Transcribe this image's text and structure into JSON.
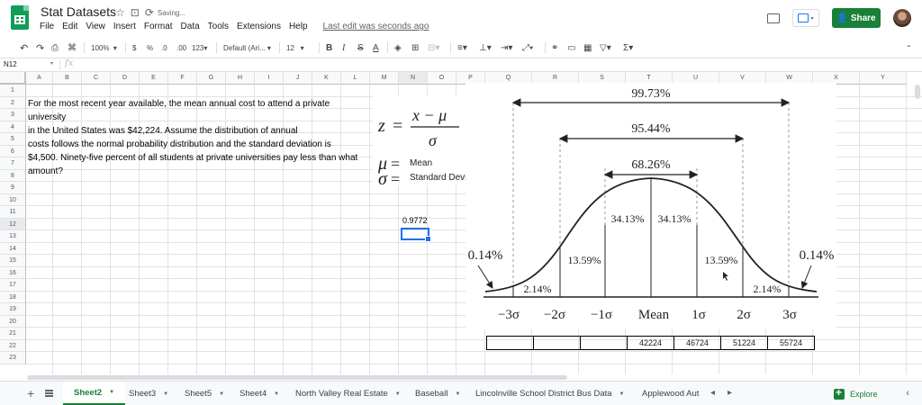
{
  "app": {
    "doc_title": "Stat Datasets",
    "saving_text": "Saving...",
    "menus": [
      "File",
      "Edit",
      "View",
      "Insert",
      "Format",
      "Data",
      "Tools",
      "Extensions",
      "Help"
    ],
    "last_edit": "Last edit was seconds ago",
    "share_label": "Share"
  },
  "toolbar": {
    "zoom": "100%",
    "currency": "$",
    "percent": "%",
    "dec_less": ".0",
    "dec_more": ".00",
    "more_formats": "123",
    "font": "Default (Ari...",
    "font_size": "12",
    "bold": "B",
    "italic": "I",
    "strike": "S",
    "text_color": "A",
    "sum": "Σ"
  },
  "formula_bar": {
    "cell_ref": "N12",
    "fx": "fx",
    "content": ""
  },
  "columns": [
    "A",
    "B",
    "C",
    "D",
    "E",
    "F",
    "G",
    "H",
    "I",
    "J",
    "K",
    "L",
    "M",
    "N",
    "O",
    "P",
    "Q",
    "R",
    "S",
    "T",
    "U",
    "V",
    "W",
    "X",
    "Y"
  ],
  "rows": [
    "1",
    "2",
    "3",
    "4",
    "5",
    "6",
    "7",
    "8",
    "9",
    "10",
    "11",
    "12",
    "13",
    "14",
    "15",
    "16",
    "17",
    "18",
    "19",
    "20",
    "21",
    "22",
    "23"
  ],
  "problem_text": [
    "For the most recent year available, the mean annual cost to attend a private",
    "university",
    "in the United States was $42,224. Assume the distribution of annual",
    "costs follows the normal probability distribution and the standard deviation is",
    "$4,500. Ninety-five percent of all students at private universities pay less than what",
    "amount?"
  ],
  "n11_value": "0.9772",
  "formula_image": {
    "mu_label": "Mean",
    "sigma_label": "Standard Deviation"
  },
  "bell_curve": {
    "pct_outer": "99.73%",
    "pct_middle": "95.44%",
    "pct_inner": "68.26%",
    "pct_center_left": "34.13%",
    "pct_center_right": "34.13%",
    "pct_13_left": "13.59%",
    "pct_13_right": "13.59%",
    "pct_2_left": "2.14%",
    "pct_2_right": "2.14%",
    "pct_tail_left": "0.14%",
    "pct_tail_right": "0.14%",
    "axis_labels": [
      "−3σ",
      "−2σ",
      "−1σ",
      "Mean",
      "1σ",
      "2σ",
      "3σ"
    ]
  },
  "table_row21": [
    "",
    "",
    "",
    "42224",
    "46724",
    "51224",
    "55724"
  ],
  "sheets": {
    "tabs": [
      "Sheet2",
      "Sheet3",
      "Sheet5",
      "Sheet4",
      "North Valley Real Estate",
      "Baseball",
      "Lincolnville School District Bus Data",
      "Applewood Aut"
    ],
    "active_index": 0,
    "explore_label": "Explore"
  },
  "colors": {
    "brand_green": "#188038",
    "selection_blue": "#1a73e8"
  }
}
